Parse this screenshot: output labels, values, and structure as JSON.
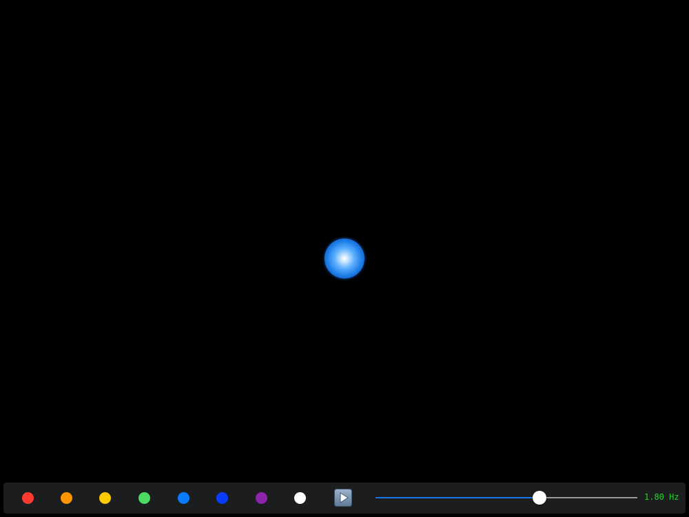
{
  "stage": {
    "orb_color": "#1f7fe8"
  },
  "toolbar": {
    "swatches": [
      {
        "name": "red",
        "color": "#ff3b30"
      },
      {
        "name": "orange",
        "color": "#ff9500"
      },
      {
        "name": "yellow",
        "color": "#ffcc00"
      },
      {
        "name": "green",
        "color": "#4cd964"
      },
      {
        "name": "light-blue",
        "color": "#0a7cff"
      },
      {
        "name": "blue",
        "color": "#0a3cff"
      },
      {
        "name": "purple",
        "color": "#8e24aa"
      },
      {
        "name": "white",
        "color": "#ffffff"
      }
    ],
    "play_icon": "play-icon",
    "frequency_slider": {
      "fraction": 0.627
    },
    "frequency_readout": "1.80 Hz"
  }
}
